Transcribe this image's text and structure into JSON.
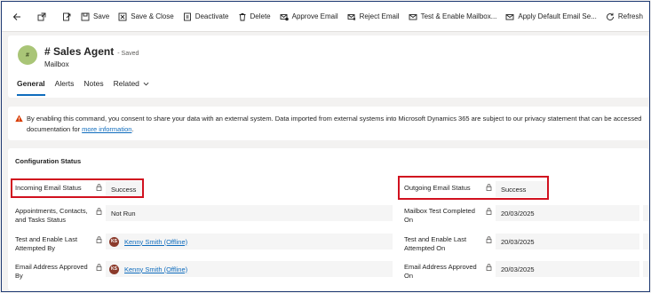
{
  "toolbar": {
    "buttons": {
      "save": "Save",
      "save_close": "Save & Close",
      "deactivate": "Deactivate",
      "delete": "Delete",
      "approve_email": "Approve Email",
      "reject_email": "Reject Email",
      "test_enable": "Test & Enable Mailbox...",
      "apply_default": "Apply Default Email Se...",
      "refresh": "Refresh"
    }
  },
  "record": {
    "avatar_initials": "#",
    "title": "# Sales Agent",
    "save_state": "- Saved",
    "entity_type": "Mailbox"
  },
  "tabs": [
    "General",
    "Alerts",
    "Notes",
    "Related"
  ],
  "notice": {
    "text_line1": "By enabling this command, you consent to share your data with an external system. Data imported from external systems into Microsoft Dynamics 365 are subject to our privacy statement that can be accessed",
    "text_line2_prefix": "documentation for",
    "link": "more information",
    "text_line2_suffix": "."
  },
  "config": {
    "section_title": "Configuration Status",
    "left": {
      "incoming_status": {
        "label": "Incoming Email Status",
        "value": "Success"
      },
      "appointments_status": {
        "label": "Appointments, Contacts, and Tasks Status",
        "value": "Not Run"
      },
      "test_enable_by": {
        "label": "Test and Enable Last Attempted By",
        "value": "Kenny Smith (Offline)",
        "initials": "KS"
      },
      "approved_by": {
        "label": "Email Address Approved By",
        "value": "Kenny Smith (Offline)",
        "initials": "KS"
      }
    },
    "right": {
      "outgoing_status": {
        "label": "Outgoing Email Status",
        "value": "Success"
      },
      "test_completed_on": {
        "label": "Mailbox Test Completed On",
        "value": "20/03/2025"
      },
      "test_enable_on": {
        "label": "Test and Enable Last Attempted On",
        "value": "20/03/2025"
      },
      "approved_on": {
        "label": "Email Address Approved On",
        "value": "20/03/2025"
      }
    }
  },
  "colors": {
    "accent": "#0f6cbd",
    "highlight": "#d1111f",
    "warning": "#d83b01",
    "avatar_record": "#a9c577",
    "avatar_user": "#8b3a2b"
  }
}
